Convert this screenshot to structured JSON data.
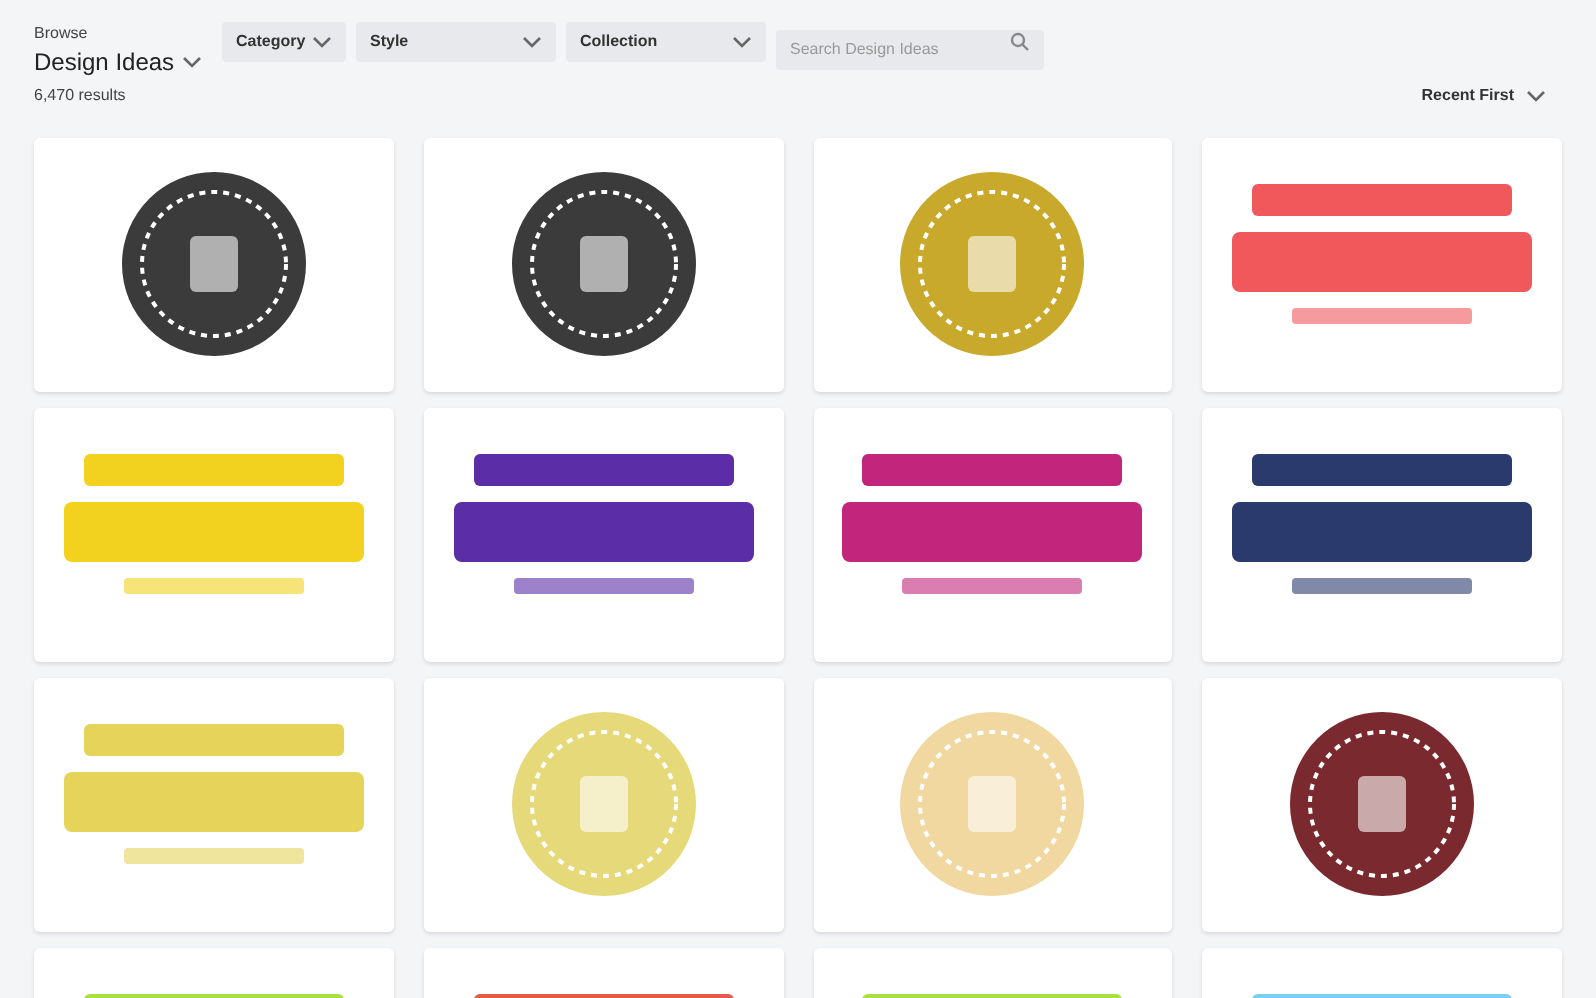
{
  "header": {
    "eyebrow": "Browse",
    "title": "Design Ideas",
    "results": "6,470 results"
  },
  "filters": [
    {
      "label": "Category"
    },
    {
      "label": "Style"
    },
    {
      "label": "Collection"
    }
  ],
  "search": {
    "placeholder": "Search Design Ideas"
  },
  "sort": {
    "label": "Recent First"
  },
  "cards": [
    {
      "kind": "circle",
      "color": "#3b3b3b"
    },
    {
      "kind": "circle",
      "color": "#3b3b3b"
    },
    {
      "kind": "circle",
      "color": "#c9a92c"
    },
    {
      "kind": "wordmark",
      "color": "#f0585c"
    },
    {
      "kind": "wordmark",
      "color": "#f2d21e"
    },
    {
      "kind": "wordmark",
      "color": "#5b2ea8"
    },
    {
      "kind": "wordmark",
      "color": "#c2267c"
    },
    {
      "kind": "wordmark",
      "color": "#2b3a6c"
    },
    {
      "kind": "wordmark",
      "color": "#e6d35a"
    },
    {
      "kind": "circle",
      "color": "#e6d97a"
    },
    {
      "kind": "circle",
      "color": "#f0d8a0"
    },
    {
      "kind": "circle",
      "color": "#7a2a2e"
    },
    {
      "kind": "wordmark",
      "color": "#a8e040"
    },
    {
      "kind": "wordmark",
      "color": "#e85a4a"
    },
    {
      "kind": "wordmark",
      "color": "#a8e040"
    },
    {
      "kind": "wordmark",
      "color": "#7ad0f0"
    }
  ]
}
